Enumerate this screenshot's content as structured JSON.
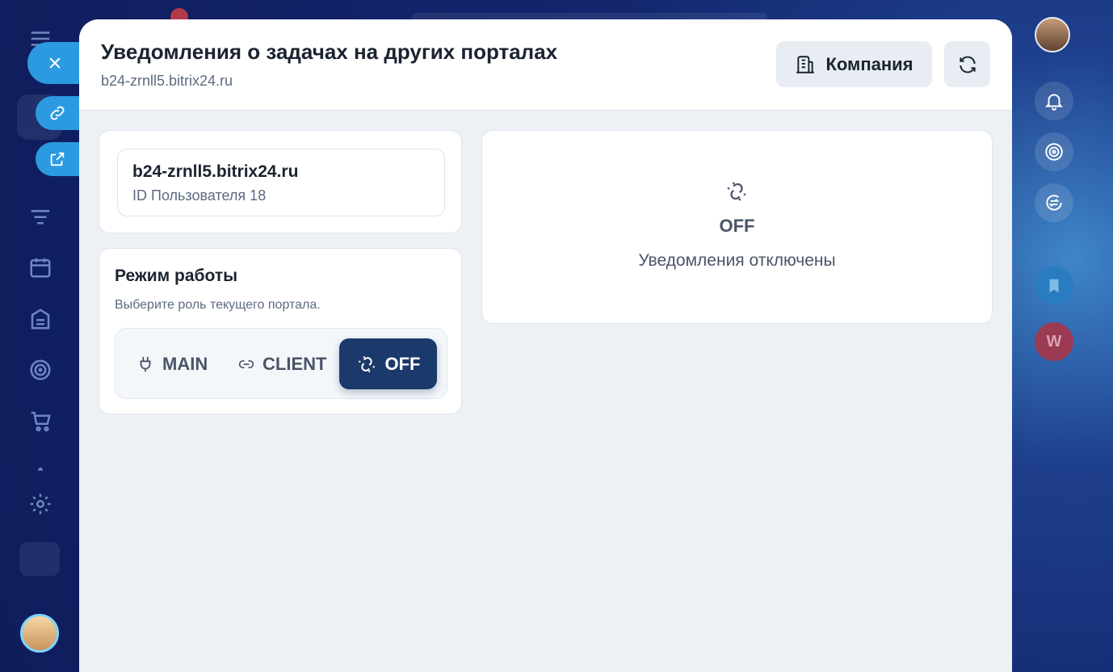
{
  "panel": {
    "title": "Уведомления о задачах на других порталах",
    "subtitle": "b24-zrnll5.bitrix24.ru",
    "company_button": "Компания"
  },
  "portal": {
    "name": "b24-zrnll5.bitrix24.ru",
    "user_id": "ID Пользователя 18"
  },
  "mode": {
    "title": "Режим работы",
    "description": "Выберите роль текущего портала.",
    "options": [
      "MAIN",
      "CLIENT",
      "OFF"
    ],
    "selected": "OFF"
  },
  "status": {
    "label": "OFF",
    "text": "Уведомления отключены"
  },
  "right_sidebar": {
    "w_avatar_letter": "W"
  },
  "colors": {
    "accent": "#1b3a6b",
    "float_button": "#2b9ae0",
    "panel_bg": "#edf1f6"
  }
}
